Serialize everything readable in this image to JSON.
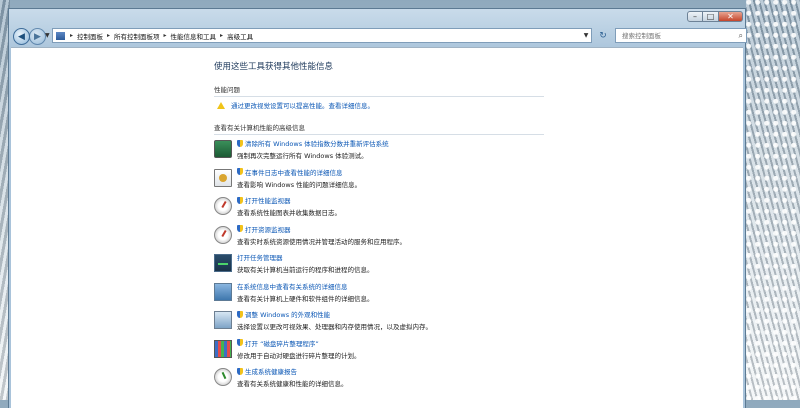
{
  "window": {
    "controls": {
      "minimize": "–",
      "maximize": "□",
      "close": "✕"
    }
  },
  "nav": {
    "back_icon": "back-arrow-icon",
    "forward_icon": "forward-arrow-icon",
    "breadcrumbs": [
      "控制面板",
      "所有控制面板项",
      "性能信息和工具",
      "高级工具"
    ],
    "search_placeholder": "搜索控制面板"
  },
  "main": {
    "title": "使用这些工具获得其他性能信息",
    "performance_issues": {
      "heading": "性能问题",
      "items": [
        {
          "text": "通过更改视觉设置可以提高性能。查看详细信息。",
          "icon": "warning-icon"
        }
      ]
    },
    "tools_heading": "查看有关计算机性能的高级信息",
    "tools": [
      {
        "icon": "monitor-icon",
        "shield": true,
        "link": "清除所有 Windows 体验指数分数并重新评估系统",
        "desc": "强制再次完整运行所有 Windows 体验测试。"
      },
      {
        "icon": "event-log-icon",
        "shield": true,
        "link": "在事件日志中查看性能的详细信息",
        "desc": "查看影响 Windows 性能的问题详细信息。"
      },
      {
        "icon": "performance-monitor-icon",
        "shield": true,
        "link": "打开性能监视器",
        "desc": "查看系统性能图表并收集数据日志。"
      },
      {
        "icon": "resource-monitor-icon",
        "shield": true,
        "link": "打开资源监视器",
        "desc": "查看实时系统资源使用情况并管理活动的服务和应用程序。"
      },
      {
        "icon": "task-manager-icon",
        "shield": false,
        "link": "打开任务管理器",
        "desc": "获取有关计算机当前运行的程序和进程的信息。"
      },
      {
        "icon": "system-info-icon",
        "shield": false,
        "link": "在系统信息中查看有关系统的详细信息",
        "desc": "查看有关计算机上硬件和软件组件的详细信息。"
      },
      {
        "icon": "visual-effects-icon",
        "shield": true,
        "link": "调整 Windows 的外观和性能",
        "desc": "选择设置以更改可视效果、处理器和内存使用情况，以及虚拟内存。"
      },
      {
        "icon": "disk-defragmenter-icon",
        "shield": true,
        "link": "打开 “磁盘碎片整理程序”",
        "desc": "修改用于自动对硬盘进行碎片整理的计划。"
      },
      {
        "icon": "system-health-icon",
        "shield": true,
        "link": "生成系统健康报告",
        "desc": "查看有关系统健康和性能的详细信息。"
      }
    ]
  }
}
